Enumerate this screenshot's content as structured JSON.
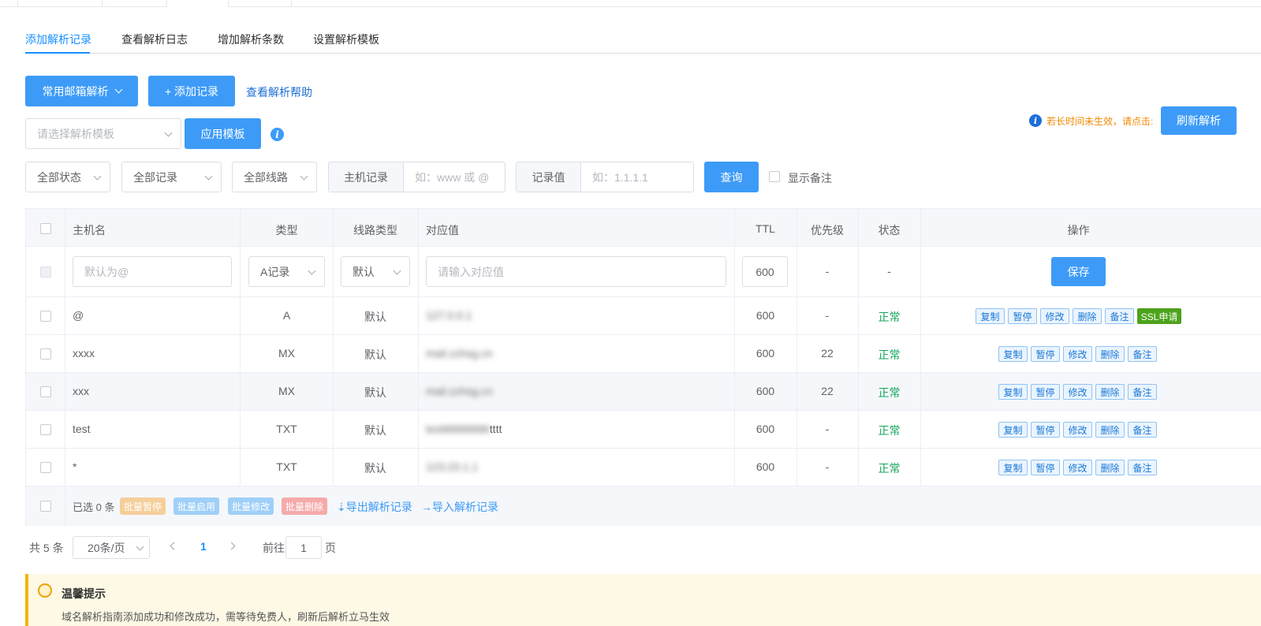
{
  "tabs": {
    "add_record": "添加解析记录",
    "view_log": "查看解析日志",
    "add_count": "增加解析条数",
    "set_template": "设置解析模板"
  },
  "toolbar": {
    "mail_parse": "常用邮箱解析",
    "add_record": "+ 添加记录",
    "help_link": "查看解析帮助",
    "template_placeholder": "请选择解析模板",
    "apply_template": "应用模板",
    "refresh_hint": "若长时间未生效，请点击:",
    "refresh_button": "刷新解析"
  },
  "filters": {
    "status": "全部状态",
    "records": "全部记录",
    "lines": "全部线路",
    "host_label": "主机记录",
    "host_placeholder": "如：www 或 @",
    "value_label": "记录值",
    "value_placeholder": "如：1.1.1.1",
    "query": "查询",
    "show_remark": "显示备注"
  },
  "table": {
    "headers": {
      "host": "主机名",
      "type": "类型",
      "line": "线路类型",
      "value": "对应值",
      "ttl": "TTL",
      "priority": "优先级",
      "status": "状态",
      "ops": "操作"
    },
    "new_row": {
      "host_placeholder": "默认为@",
      "type": "A记录",
      "line": "默认",
      "value_placeholder": "请输入对应值",
      "ttl": "600",
      "priority": "-",
      "status": "-",
      "save": "保存"
    },
    "rows": [
      {
        "host": "@",
        "type": "A",
        "line": "默认",
        "value": "127.0.0.1",
        "value_suffix": "",
        "ttl": "600",
        "priority": "-",
        "status": "正常"
      },
      {
        "host": "xxxx",
        "type": "MX",
        "line": "默认",
        "value": "mail.zzhsg.cn",
        "value_suffix": "",
        "ttl": "600",
        "priority": "22",
        "status": "正常"
      },
      {
        "host": "xxx",
        "type": "MX",
        "line": "默认",
        "value": "mail.zzhsg.cn",
        "value_suffix": "",
        "ttl": "600",
        "priority": "22",
        "status": "正常"
      },
      {
        "host": "test",
        "type": "TXT",
        "line": "默认",
        "value": "testttttttttttttttt",
        "value_suffix": "tttt",
        "ttl": "600",
        "priority": "-",
        "status": "正常"
      },
      {
        "host": "*",
        "type": "TXT",
        "line": "默认",
        "value": "123.23.1.1",
        "value_suffix": "",
        "ttl": "600",
        "priority": "-",
        "status": "正常"
      }
    ],
    "ops": {
      "copy": "复制",
      "pause": "暂停",
      "edit": "修改",
      "delete": "删除",
      "remark": "备注",
      "ssl": "SSL申请"
    },
    "footer": {
      "selected": "已选 0 条",
      "batch_pause": "批量暂停",
      "batch_enable": "批量启用",
      "batch_edit": "批量修改",
      "batch_delete": "批量删除",
      "export": "⇣导出解析记录",
      "import": "→导入解析记录"
    }
  },
  "pagination": {
    "total": "共 5 条",
    "page_size": "20条/页",
    "current": "1",
    "goto_label": "前往",
    "goto_value": "1",
    "page_suffix": "页"
  },
  "tip": {
    "title": "温馨提示",
    "body": "域名解析指南添加成功和修改成功，需等待免费人，刷新后解析立马生效"
  },
  "colors": {
    "primary": "#3d9bf7",
    "link": "#1d6fd8",
    "success": "#13a55b",
    "warning": "#f08a00",
    "ssl": "#4da31c"
  }
}
